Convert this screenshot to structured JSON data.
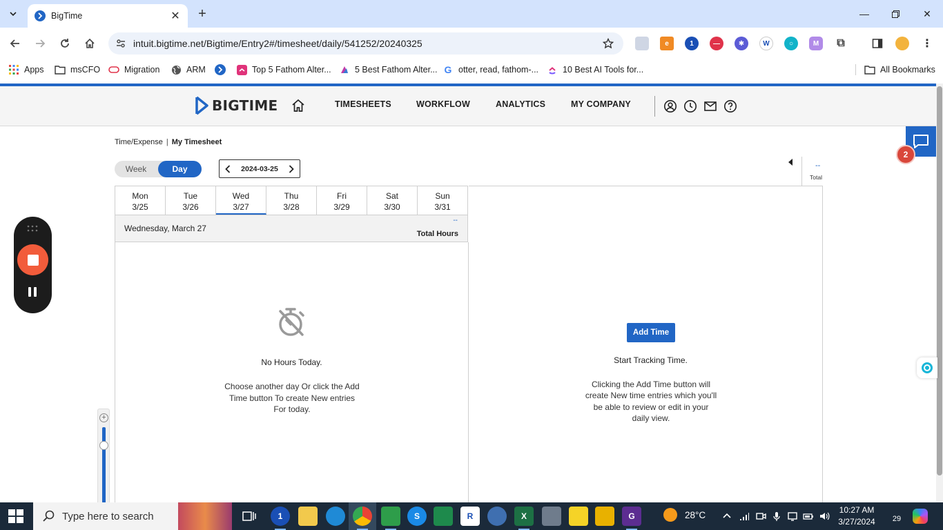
{
  "browser": {
    "tab_title": "BigTime",
    "url": "intuit.bigtime.net/Bigtime/Entry2#/timesheet/daily/541252/20240325",
    "bookmarks": [
      {
        "label": "Apps",
        "icon": "apps-grid-icon"
      },
      {
        "label": "msCFO",
        "icon": "folder-icon"
      },
      {
        "label": "Migration",
        "icon": "link-icon"
      },
      {
        "label": "ARM",
        "icon": "globe-icon"
      },
      {
        "label": "",
        "icon": "bigtime-favicon-icon"
      },
      {
        "label": "Top 5 Fathom Alter...",
        "icon": "clickup-icon"
      },
      {
        "label": "5 Best Fathom Alter...",
        "icon": "bookmark-page-icon"
      },
      {
        "label": "otter, read, fathom-...",
        "icon": "google-icon"
      },
      {
        "label": "10 Best AI Tools for...",
        "icon": "clickup-icon"
      }
    ],
    "all_bookmarks_label": "All Bookmarks"
  },
  "header": {
    "brand": "BIGTIME",
    "nav": [
      "TIMESHEETS",
      "WORKFLOW",
      "ANALYTICS",
      "MY COMPANY"
    ]
  },
  "breadcrumb": {
    "parent": "Time/Expense",
    "separator": "|",
    "current": "My Timesheet"
  },
  "view_toggle": {
    "week": "Week",
    "day": "Day",
    "selected": "Day"
  },
  "date_nav": {
    "date": "2024-03-25"
  },
  "total": {
    "value": "--",
    "label": "Total"
  },
  "week_days": [
    {
      "name": "Mon",
      "date": "3/25"
    },
    {
      "name": "Tue",
      "date": "3/26"
    },
    {
      "name": "Wed",
      "date": "3/27"
    },
    {
      "name": "Thu",
      "date": "3/28"
    },
    {
      "name": "Fri",
      "date": "3/29"
    },
    {
      "name": "Sat",
      "date": "3/30"
    },
    {
      "name": "Sun",
      "date": "3/31"
    }
  ],
  "active_day_index": 2,
  "day_summary": {
    "title": "Wednesday, March 27",
    "hours_value": "--",
    "hours_label": "Total Hours"
  },
  "empty_state": {
    "title": "No Hours Today.",
    "description": "Choose another day Or click the Add Time button To create New entries For today."
  },
  "right_panel": {
    "button": "Add Time",
    "title": "Start Tracking Time.",
    "description": "Clicking the Add Time button will create New time entries which you'll be able to review or edit in your daily view."
  },
  "chat_badge_count": "2",
  "taskbar": {
    "search_placeholder": "Type here to search",
    "temperature": "28°C",
    "time": "10:27 AM",
    "date": "3/27/2024",
    "notification_count": "29"
  },
  "colors": {
    "accent": "#2166c5",
    "record": "#f25c3b",
    "badge": "#d9473b"
  }
}
